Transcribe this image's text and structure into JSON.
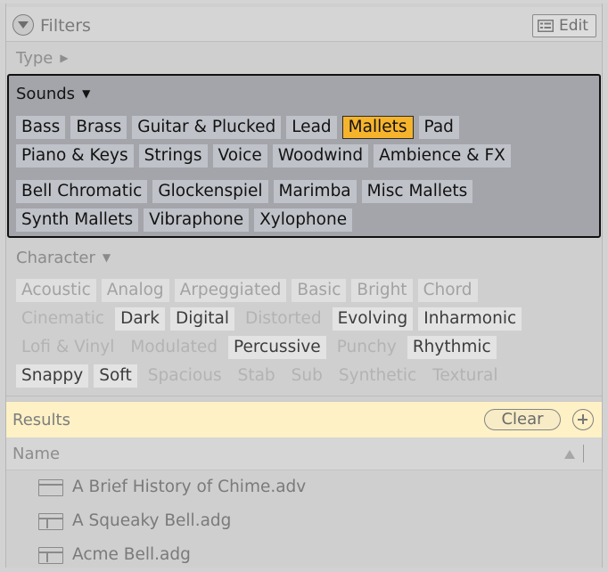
{
  "filters": {
    "title": "Filters",
    "edit_label": "Edit"
  },
  "type_row": {
    "label": "Type"
  },
  "sounds": {
    "title": "Sounds",
    "rows": [
      [
        "Bass",
        "Brass",
        "Guitar & Plucked",
        "Lead",
        "Mallets",
        "Pad"
      ],
      [
        "Piano & Keys",
        "Strings",
        "Voice",
        "Woodwind",
        "Ambience & FX"
      ],
      [
        "Bell Chromatic",
        "Glockenspiel",
        "Marimba",
        "Misc Mallets"
      ],
      [
        "Synth Mallets",
        "Vibraphone",
        "Xylophone"
      ]
    ],
    "selected": "Mallets"
  },
  "character": {
    "title": "Character",
    "rows": [
      [
        {
          "label": "Acoustic",
          "state": "available"
        },
        {
          "label": "Analog",
          "state": "available"
        },
        {
          "label": "Arpeggiated",
          "state": "available"
        },
        {
          "label": "Basic",
          "state": "available"
        },
        {
          "label": "Bright",
          "state": "available"
        },
        {
          "label": "Chord",
          "state": "available"
        }
      ],
      [
        {
          "label": "Cinematic",
          "state": "unavailable"
        },
        {
          "label": "Dark",
          "state": "active"
        },
        {
          "label": "Digital",
          "state": "active"
        },
        {
          "label": "Distorted",
          "state": "unavailable"
        },
        {
          "label": "Evolving",
          "state": "active"
        },
        {
          "label": "Inharmonic",
          "state": "active"
        }
      ],
      [
        {
          "label": "Lofi & Vinyl",
          "state": "unavailable"
        },
        {
          "label": "Modulated",
          "state": "unavailable"
        },
        {
          "label": "Percussive",
          "state": "active"
        },
        {
          "label": "Punchy",
          "state": "unavailable"
        },
        {
          "label": "Rhythmic",
          "state": "active"
        }
      ],
      [
        {
          "label": "Snappy",
          "state": "active"
        },
        {
          "label": "Soft",
          "state": "active"
        },
        {
          "label": "Spacious",
          "state": "unavailable"
        },
        {
          "label": "Stab",
          "state": "unavailable"
        },
        {
          "label": "Sub",
          "state": "unavailable"
        },
        {
          "label": "Synthetic",
          "state": "unavailable"
        },
        {
          "label": "Textural",
          "state": "unavailable"
        }
      ]
    ]
  },
  "results": {
    "label": "Results",
    "clear_label": "Clear"
  },
  "columns": {
    "name": "Name"
  },
  "files": [
    {
      "name": "A Brief History of Chime.adv",
      "icon": "preset-icon"
    },
    {
      "name": "A Squeaky Bell.adg",
      "icon": "rack-icon"
    },
    {
      "name": "Acme Bell.adg",
      "icon": "rack-icon"
    }
  ]
}
